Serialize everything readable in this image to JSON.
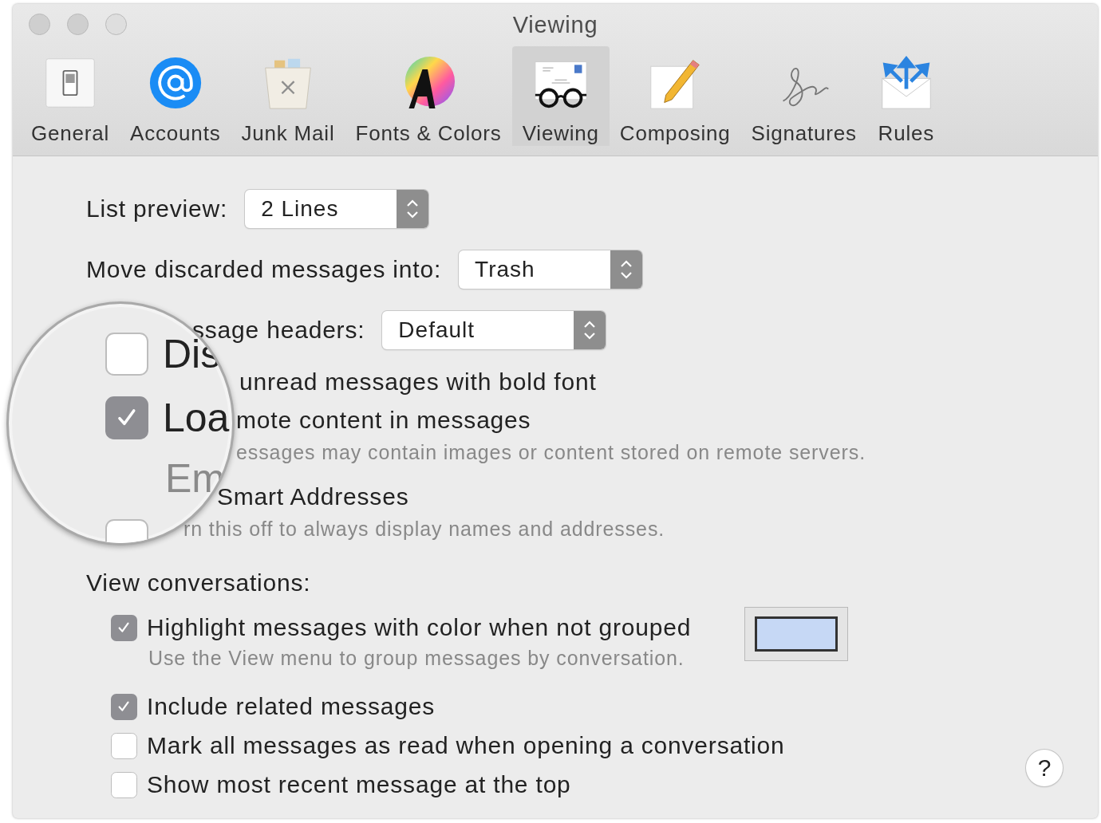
{
  "window": {
    "title": "Viewing"
  },
  "toolbar": [
    {
      "label": "General",
      "selected": false
    },
    {
      "label": "Accounts",
      "selected": false
    },
    {
      "label": "Junk Mail",
      "selected": false
    },
    {
      "label": "Fonts & Colors",
      "selected": false
    },
    {
      "label": "Viewing",
      "selected": true
    },
    {
      "label": "Composing",
      "selected": false
    },
    {
      "label": "Signatures",
      "selected": false
    },
    {
      "label": "Rules",
      "selected": false
    }
  ],
  "popups": [
    {
      "label": "List preview:",
      "value": "2 Lines"
    },
    {
      "label": "Move discarded messages into:",
      "value": "Trash"
    },
    {
      "label": "ssage headers:",
      "value": "Default"
    }
  ],
  "options": [
    {
      "label": "unread messages with bold font"
    },
    {
      "label": "mote content in messages",
      "note": "essages may contain images or content stored on remote servers."
    },
    {
      "label": "Smart Addresses",
      "note": "rn this off to always display names and addresses."
    }
  ],
  "magnifier": [
    {
      "label": "Dis",
      "kind": "checkbox",
      "checked": false
    },
    {
      "label": "Loa",
      "kind": "checkbox",
      "checked": true
    },
    {
      "label": "Em",
      "kind": "note"
    },
    {
      "kind": "checkbox",
      "checked": false
    }
  ],
  "conversations": {
    "heading": "View conversations:",
    "options": [
      {
        "label": "Highlight messages with color when not grouped",
        "checked": true,
        "note": "Use the View menu to group messages by conversation.",
        "swatch": true
      },
      {
        "label": "Include related messages",
        "checked": true
      },
      {
        "label": "Mark all messages as read when opening a conversation",
        "checked": false
      },
      {
        "label": "Show most recent message at the top",
        "checked": false
      }
    ]
  },
  "help_button": "?"
}
